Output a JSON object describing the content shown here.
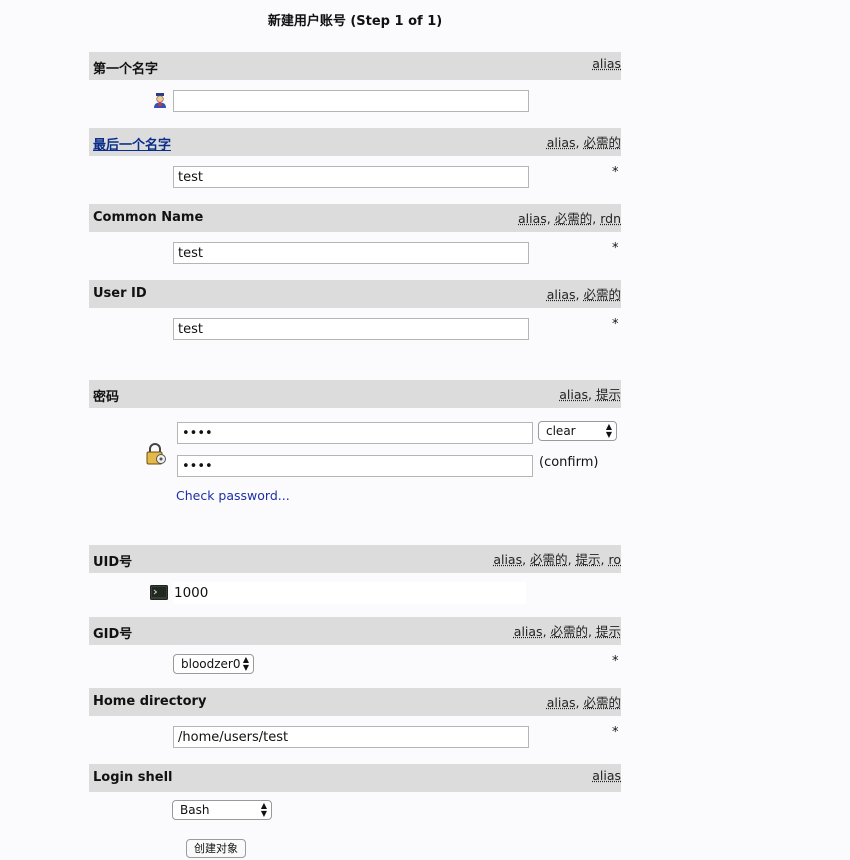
{
  "page": {
    "title": "新建用户账号 (Step 1 of 1)"
  },
  "first_name": {
    "label": "第一个名字",
    "tags": [
      "alias"
    ],
    "value": ""
  },
  "last_name": {
    "label": "最后一个名字",
    "tags": [
      "alias",
      "必需的"
    ],
    "value": "test",
    "required_mark": "*"
  },
  "common_name": {
    "label": "Common Name",
    "tags": [
      "alias",
      "必需的",
      "rdn"
    ],
    "value": "test",
    "required_mark": "*"
  },
  "user_id": {
    "label": "User ID",
    "tags": [
      "alias",
      "必需的"
    ],
    "value": "test",
    "required_mark": "*"
  },
  "password": {
    "label": "密码",
    "tags": [
      "alias",
      "提示"
    ],
    "value": "••••",
    "confirm_value": "••••",
    "hash_select": "clear",
    "confirm_label": "(confirm)",
    "check_link": "Check password..."
  },
  "uid_number": {
    "label": "UID号",
    "tags": [
      "alias",
      "必需的",
      "提示",
      "ro"
    ],
    "value": "1000"
  },
  "gid_number": {
    "label": "GID号",
    "tags": [
      "alias",
      "必需的",
      "提示"
    ],
    "select_value": "bloodzer0",
    "required_mark": "*"
  },
  "home_directory": {
    "label": "Home directory",
    "tags": [
      "alias",
      "必需的"
    ],
    "value": "/home/users/test",
    "required_mark": "*"
  },
  "login_shell": {
    "label": "Login shell",
    "tags": [
      "alias"
    ],
    "select_value": "Bash"
  },
  "create_button": {
    "label": "创建对象"
  },
  "icons": {
    "first_name": "user-icon",
    "password": "lock-icon",
    "uid": "terminal-icon"
  }
}
